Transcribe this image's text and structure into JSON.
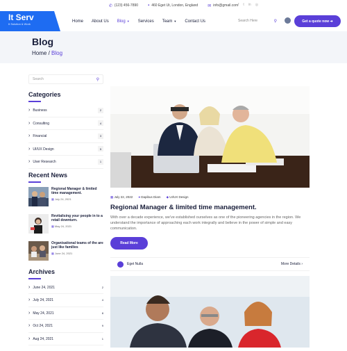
{
  "topbar": {
    "phone": "(123) 456-7890",
    "address": "460 Eget Ut, London, England",
    "email": "info@gmail.com"
  },
  "brand": {
    "name": "It Serv",
    "tagline": "It Solution & Work"
  },
  "nav": {
    "items": [
      "Home",
      "About Us",
      "Blog",
      "Services",
      "Team",
      "Contact Us"
    ],
    "search_placeholder": "Search Here",
    "cta": "Get a quote now"
  },
  "banner": {
    "title": "Blog",
    "crumb_home": "Home",
    "crumb_sep": " / ",
    "crumb_current": "Blog"
  },
  "sidebar": {
    "search_placeholder": "Search",
    "categories_title": "Categories",
    "categories": [
      {
        "label": "Business",
        "count": "2"
      },
      {
        "label": "Consulting",
        "count": "4"
      },
      {
        "label": "Financial",
        "count": "3"
      },
      {
        "label": "UI/UX Design",
        "count": "5"
      },
      {
        "label": "User Research",
        "count": "1"
      }
    ],
    "recent_title": "Recent News",
    "recent": [
      {
        "title": "Regional Manager & limited time management.",
        "date": "July 24, 2021"
      },
      {
        "title": "Revitalising your people in to a retail downturn.",
        "date": "May 24, 2021"
      },
      {
        "title": "Organisational teams of the are just like families",
        "date": "June 24, 2021"
      }
    ],
    "archives_title": "Archives",
    "archives": [
      {
        "label": "June 24, 2021",
        "count": "2"
      },
      {
        "label": "July 24, 2021",
        "count": "4"
      },
      {
        "label": "May 24, 2021",
        "count": "8"
      },
      {
        "label": "Oct 24, 2021",
        "count": "9"
      },
      {
        "label": "Aug 24, 2021",
        "count": "1"
      }
    ]
  },
  "post": {
    "date": "July 22, 2022",
    "author_meta": "Dapibus Diam",
    "category": "UI/UX Design",
    "title": "Regional Manager & limited time management.",
    "excerpt": "With over a decade experience, we've established ourselves as one of the pioneering agencies in the region. We understand the importance of approaching each work integrally and believe in the power of simple and easy communication.",
    "read_more": "Read More",
    "author": "Eget Nulla",
    "more_details": "More Details"
  },
  "colors": {
    "accent": "#5a3fd8",
    "brand": "#1e6cf2"
  }
}
